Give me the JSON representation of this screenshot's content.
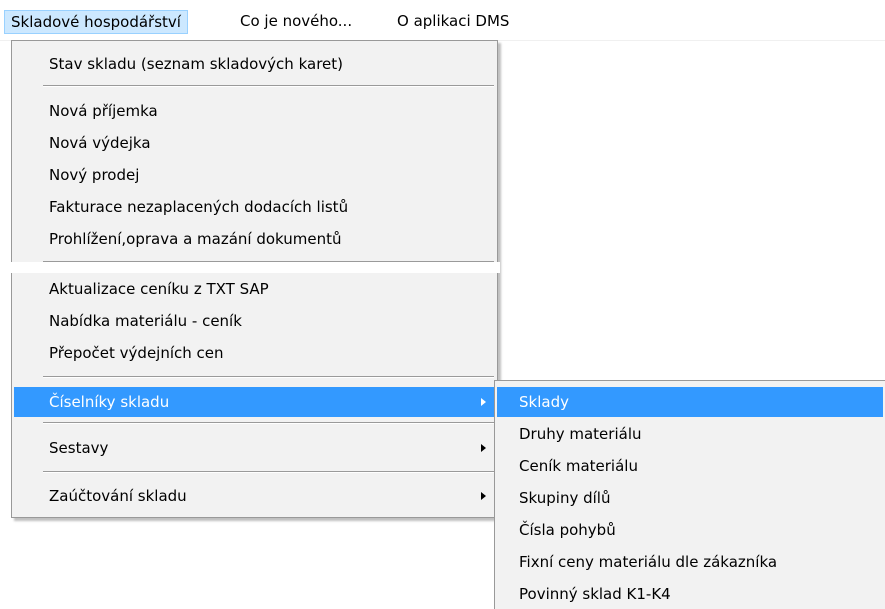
{
  "menubar": {
    "items": [
      {
        "label": "Skladové hospodářství"
      },
      {
        "label": "Co je nového..."
      },
      {
        "label": "O aplikaci DMS"
      }
    ]
  },
  "menu": {
    "items": [
      {
        "label": "Stav skladu (seznam skladových karet)"
      },
      {
        "label": "Nová příjemka"
      },
      {
        "label": "Nová výdejka"
      },
      {
        "label": "Nový prodej"
      },
      {
        "label": "Fakturace nezaplacených dodacích listů"
      },
      {
        "label": "Prohlížení,oprava a mazání dokumentů"
      },
      {
        "label": "Aktualizace ceníku z TXT SAP"
      },
      {
        "label": "Nabídka materiálu - ceník"
      },
      {
        "label": "Přepočet výdejních cen"
      },
      {
        "label": "Číselníky skladu"
      },
      {
        "label": "Sestavy"
      },
      {
        "label": "Zaúčtování skladu"
      }
    ]
  },
  "submenu": {
    "items": [
      {
        "label": "Sklady"
      },
      {
        "label": "Druhy materiálu"
      },
      {
        "label": "Ceník materiálu"
      },
      {
        "label": "Skupiny dílů"
      },
      {
        "label": "Čísla pohybů"
      },
      {
        "label": "Fixní ceny materiálu dle zákazníka"
      },
      {
        "label": "Povinný sklad K1-K4"
      }
    ]
  },
  "colors": {
    "highlight": "#3399ff",
    "menubar_active": "#cce8ff",
    "menu_background": "#f2f2f2"
  }
}
